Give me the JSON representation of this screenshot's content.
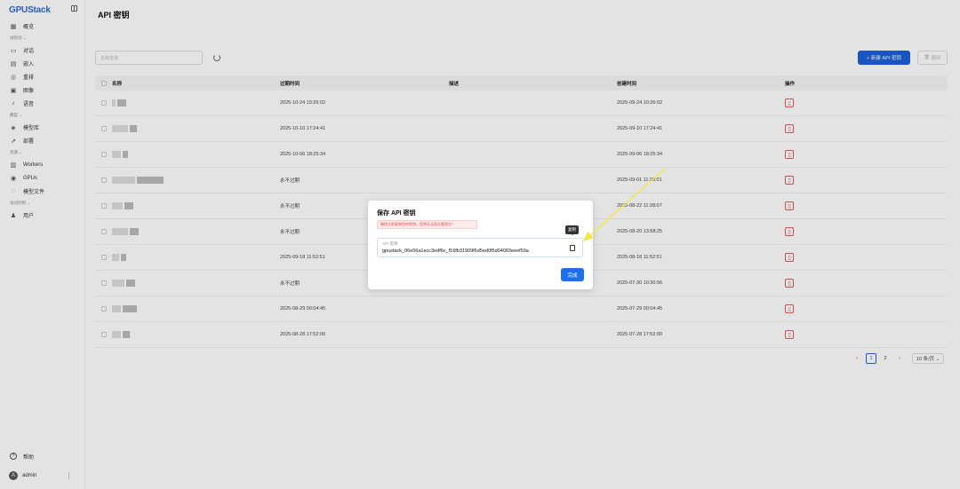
{
  "app": {
    "logo": "GPUStack",
    "page_title": "API 密钥"
  },
  "sidebar": {
    "groups": [
      {
        "label": "",
        "items": [
          {
            "label": "概览",
            "icon": "dashboard-icon"
          }
        ]
      },
      {
        "label": "试验场 ⌄",
        "items": [
          {
            "label": "对话",
            "icon": "chat-icon"
          },
          {
            "label": "嵌入",
            "icon": "embed-icon"
          },
          {
            "label": "重排",
            "icon": "rerank-icon"
          },
          {
            "label": "图像",
            "icon": "image-icon"
          },
          {
            "label": "语音",
            "icon": "audio-icon"
          }
        ]
      },
      {
        "label": "模型 ⌄",
        "items": [
          {
            "label": "模型库",
            "icon": "catalog-icon"
          },
          {
            "label": "部署",
            "icon": "deploy-icon"
          }
        ]
      },
      {
        "label": "资源 ⌄",
        "items": [
          {
            "label": "Workers",
            "icon": "server-icon"
          },
          {
            "label": "GPUs",
            "icon": "gpu-icon"
          },
          {
            "label": "模型文件",
            "icon": "file-icon"
          }
        ]
      },
      {
        "label": "访问控制 ⌄",
        "items": [
          {
            "label": "用户",
            "icon": "users-icon"
          }
        ]
      }
    ],
    "help": "帮助",
    "user": {
      "avatar": "A",
      "name": "admin"
    }
  },
  "toolbar": {
    "search_placeholder": "名称查询",
    "new_button": "+ 新建 API 密钥",
    "delete_button": "删除"
  },
  "table": {
    "headers": {
      "name": "名称",
      "expires": "过期时间",
      "description": "描述",
      "created": "创建时间",
      "action": "操作"
    },
    "rows": [
      {
        "expires": "2025-10-24 10:26:02",
        "description": "",
        "created": "2025-09-24 10:26:02"
      },
      {
        "expires": "2025-10-10 17:24:41",
        "description": "",
        "created": "2025-09-10 17:24:41"
      },
      {
        "expires": "2025-10-06 18:25:34",
        "description": "",
        "created": "2025-09-06 18:25:34"
      },
      {
        "expires": "永不过期",
        "description": "",
        "created": "2025-09-01 11:28:01"
      },
      {
        "expires": "永不过期",
        "description": "",
        "created": "2025-08-22 11:28:07"
      },
      {
        "expires": "永不过期",
        "description": "",
        "created": "2025-08-20 13:58:25"
      },
      {
        "expires": "2025-09-18 11:52:51",
        "description": "",
        "created": "2025-08-18 11:52:51"
      },
      {
        "expires": "永不过期",
        "description": "",
        "created": "2025-07-30 10:30:56"
      },
      {
        "expires": "2025-08-29 00:04:45",
        "description": "",
        "created": "2025-07-29 00:04:45"
      },
      {
        "expires": "2025-08-28 17:52:00",
        "description": "",
        "created": "2025-07-28 17:52:00"
      }
    ]
  },
  "pagination": {
    "prev": "‹",
    "pages": [
      "1",
      "2"
    ],
    "next": "›",
    "size": "10 条/页 ⌄"
  },
  "modal": {
    "title": "保存 API 密钥",
    "warning": "确保立即复制您的密钥。您将无法再次看到它！",
    "key_label": "API 密钥",
    "key_value": "gpustack_06e56a1ecc3edf6c_f16fb31909f6d5ed0f5d04083eeef59a",
    "copy_tooltip": "复制",
    "done_button": "完成"
  },
  "colors": {
    "primary": "#1e5fd8",
    "danger": "#e05a5a",
    "annotation": "#f2e84a"
  }
}
